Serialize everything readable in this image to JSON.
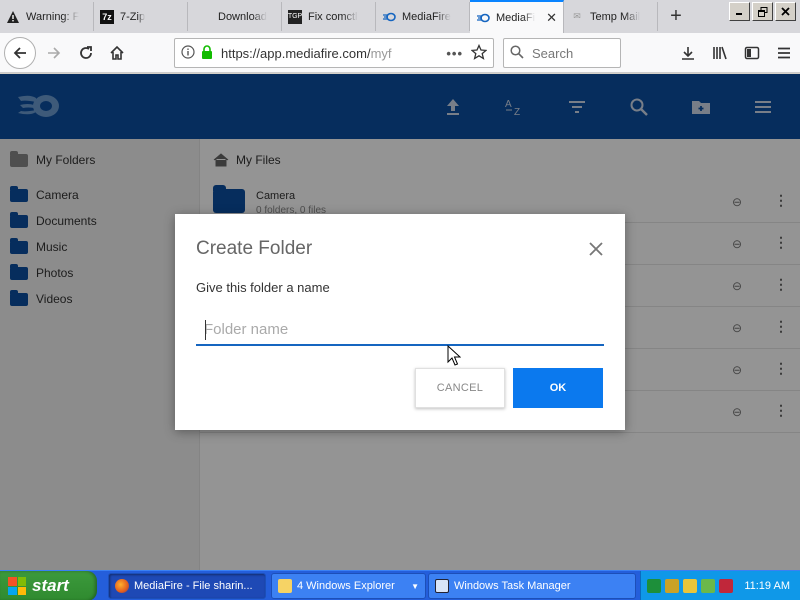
{
  "browser": {
    "tabs": [
      {
        "label": "Warning: F",
        "icon": "warning-icon"
      },
      {
        "label": "7-Zip",
        "icon": "7zip-icon"
      },
      {
        "label": "Download",
        "icon": "download-icon"
      },
      {
        "label": "Fix comctl",
        "icon": "tgp-icon"
      },
      {
        "label": "MediaFire",
        "icon": "mediafire-icon"
      },
      {
        "label": "MediaFi",
        "icon": "mediafire-icon",
        "active": true
      },
      {
        "label": "Temp Mail",
        "icon": "tempmail-icon"
      }
    ],
    "url_main": "https://app.mediafire.com/",
    "url_rest": "myf",
    "search_placeholder": "Search"
  },
  "sidebar": {
    "title": "My Folders",
    "items": [
      "Camera",
      "Documents",
      "Music",
      "Photos",
      "Videos"
    ]
  },
  "main": {
    "breadcrumb": "My Files",
    "rows": [
      {
        "name": "Camera",
        "meta": "0 folders, 0 files"
      },
      {
        "name": "",
        "meta": ""
      },
      {
        "name": "",
        "meta": ""
      },
      {
        "name": "",
        "meta": ""
      },
      {
        "name": "",
        "meta": ""
      },
      {
        "name": "",
        "meta": ""
      }
    ]
  },
  "dialog": {
    "title": "Create Folder",
    "subtitle": "Give this folder a name",
    "placeholder": "Folder name",
    "cancel_label": "CANCEL",
    "ok_label": "OK"
  },
  "taskbar": {
    "start_label": "start",
    "tasks": [
      {
        "label": "MediaFire - File sharin...",
        "active": true
      },
      {
        "label": "4 Windows Explorer"
      },
      {
        "label": "Windows Task Manager"
      }
    ],
    "clock": "11:19 AM"
  },
  "colors": {
    "brand_blue": "#0b4fa1",
    "ok_button": "#0b79ee",
    "input_underline": "#1565c0"
  }
}
